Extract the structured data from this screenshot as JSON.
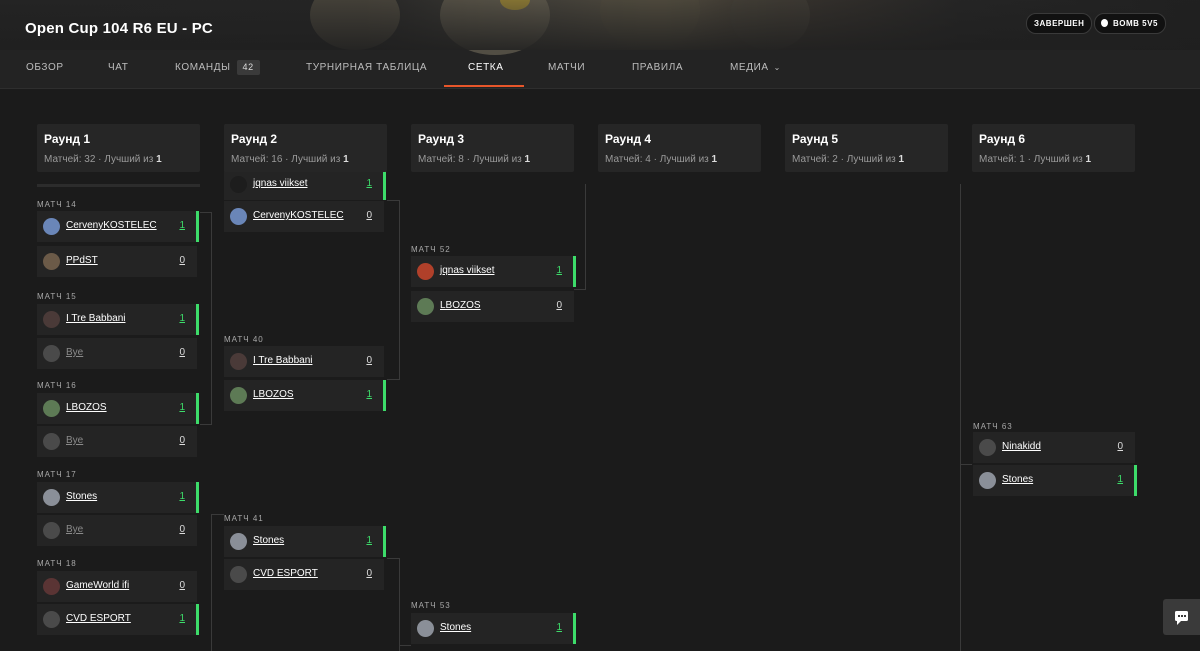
{
  "header": {
    "title": "Open Cup 104 R6 EU - PC",
    "status_badge": "ЗАВЕРШЕН",
    "mode_badge": "BOMB 5V5"
  },
  "tabs": [
    {
      "label": "ОБЗОР"
    },
    {
      "label": "ЧАТ"
    },
    {
      "label": "КОМАНДЫ",
      "count": "42"
    },
    {
      "label": "ТУРНИРНАЯ ТАБЛИЦА"
    },
    {
      "label": "СЕТКА",
      "active": true
    },
    {
      "label": "МАТЧИ"
    },
    {
      "label": "ПРАВИЛА"
    },
    {
      "label": "МЕДИА"
    }
  ],
  "rounds": [
    {
      "title": "Раунд 1",
      "matches_label": "Матчей: 32 · Лучший из ",
      "best_of": "1"
    },
    {
      "title": "Раунд 2",
      "matches_label": "Матчей: 16 · Лучший из ",
      "best_of": "1"
    },
    {
      "title": "Раунд 3",
      "matches_label": "Матчей: 8 · Лучший из ",
      "best_of": "1"
    },
    {
      "title": "Раунд 4",
      "matches_label": "Матчей: 4 · Лучший из ",
      "best_of": "1"
    },
    {
      "title": "Раунд 5",
      "matches_label": "Матчей: 2 · Лучший из ",
      "best_of": "1"
    },
    {
      "title": "Раунд 6",
      "matches_label": "Матчей: 1 · Лучший из ",
      "best_of": "1"
    }
  ],
  "matches": {
    "m14": {
      "label": "МАТЧ 14",
      "teams": [
        {
          "name": "CervenyKOSTELEC",
          "score": "1",
          "win": true
        },
        {
          "name": "PPdST",
          "score": "0"
        }
      ]
    },
    "m15": {
      "label": "МАТЧ 15",
      "teams": [
        {
          "name": "I Tre Babbani",
          "score": "1",
          "win": true
        },
        {
          "name": "Bye",
          "score": "0"
        }
      ]
    },
    "m16": {
      "label": "МАТЧ 16",
      "teams": [
        {
          "name": "LBOZOS",
          "score": "1",
          "win": true
        },
        {
          "name": "Bye",
          "score": "0"
        }
      ]
    },
    "m17": {
      "label": "МАТЧ 17",
      "teams": [
        {
          "name": "Stones",
          "score": "1",
          "win": true
        },
        {
          "name": "Bye",
          "score": "0"
        }
      ]
    },
    "m18": {
      "label": "МАТЧ 18",
      "teams": [
        {
          "name": "GameWorld ifi",
          "score": "0"
        },
        {
          "name": "CVD ESPORT",
          "score": "1",
          "win": true
        }
      ]
    },
    "m39": {
      "teams": [
        {
          "name": "jqnas viikset",
          "score": "1",
          "win": true
        },
        {
          "name": "CervenyKOSTELEC",
          "score": "0"
        }
      ]
    },
    "m40": {
      "label": "МАТЧ 40",
      "teams": [
        {
          "name": "I Tre Babbani",
          "score": "0"
        },
        {
          "name": "LBOZOS",
          "score": "1",
          "win": true
        }
      ]
    },
    "m41": {
      "label": "МАТЧ 41",
      "teams": [
        {
          "name": "Stones",
          "score": "1",
          "win": true
        },
        {
          "name": "CVD ESPORT",
          "score": "0"
        }
      ]
    },
    "m52": {
      "label": "МАТЧ 52",
      "teams": [
        {
          "name": "jqnas viikset",
          "score": "1",
          "win": true
        },
        {
          "name": "LBOZOS",
          "score": "0"
        }
      ]
    },
    "m53": {
      "label": "МАТЧ 53",
      "teams": [
        {
          "name": "Stones",
          "score": "1",
          "win": true
        }
      ]
    },
    "m63": {
      "label": "МАТЧ 63",
      "teams": [
        {
          "name": "Ninakidd",
          "score": "0"
        },
        {
          "name": "Stones",
          "score": "1",
          "win": true
        }
      ]
    }
  },
  "colors": {
    "accent": "#e8562a",
    "win": "#3ddc6a",
    "background": "#1b1b1b"
  },
  "icons": {
    "chat_button": "chat-bubble-icon",
    "mode_badge": "bomb-icon",
    "media_dropdown": "chevron-down-icon"
  }
}
